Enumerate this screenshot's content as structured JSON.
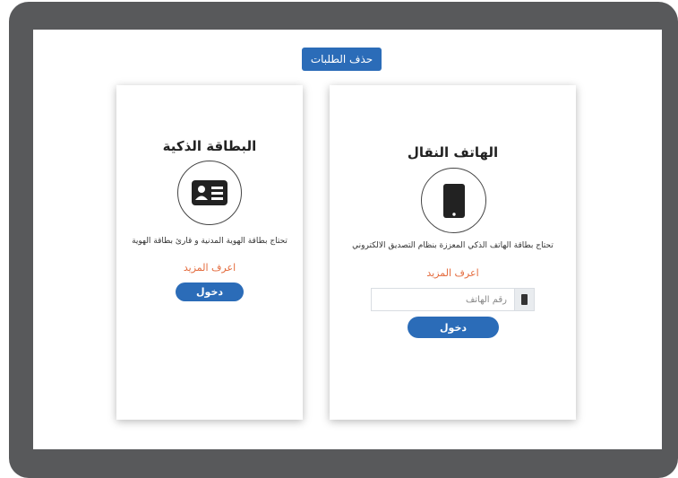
{
  "top": {
    "delete_requests_label": "حذف الطلبات"
  },
  "mobile_card": {
    "title": "الهاتف النقال",
    "icon": "mobile-phone-icon",
    "description": "تحتاج بطاقة الهاتف الذكي المعززة بنظام التصديق الالكتروني",
    "learn_more": "اعرف المزيد",
    "phone_placeholder": "رقم الهاتف",
    "phone_value": "",
    "login_label": "دخول"
  },
  "smart_card": {
    "title": "البطاقة الذكية",
    "icon": "id-card-icon",
    "description": "تحتاج بطاقة الهوية المدنية و قارئ بطاقة الهوية",
    "learn_more": "اعرف المزيد",
    "login_label": "دخول"
  },
  "colors": {
    "primary": "#2b6cb8",
    "link": "#e46b3d",
    "frame": "#58595b"
  }
}
